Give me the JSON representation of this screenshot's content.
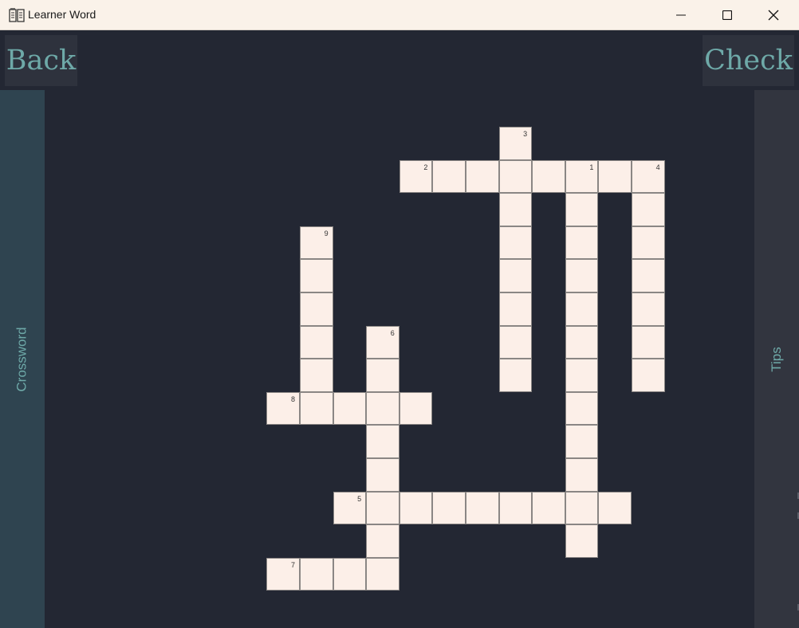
{
  "window": {
    "title": "Learner Word"
  },
  "toolbar": {
    "back_label": "Back",
    "check_label": "Check"
  },
  "sidebar_left": {
    "label": "Crossword"
  },
  "sidebar_right": {
    "label": "Tips"
  },
  "crossword": {
    "clue_numbers": [
      "1",
      "2",
      "3",
      "4",
      "5",
      "6",
      "7",
      "8",
      "9"
    ],
    "cells": [
      [
        0,
        6,
        "3"
      ],
      [
        1,
        3,
        "2"
      ],
      [
        1,
        4,
        ""
      ],
      [
        1,
        5,
        ""
      ],
      [
        1,
        6,
        ""
      ],
      [
        1,
        7,
        ""
      ],
      [
        1,
        8,
        "1"
      ],
      [
        1,
        9,
        ""
      ],
      [
        1,
        10,
        "4"
      ],
      [
        2,
        6,
        ""
      ],
      [
        2,
        8,
        ""
      ],
      [
        2,
        10,
        ""
      ],
      [
        3,
        0,
        "9"
      ],
      [
        3,
        6,
        ""
      ],
      [
        3,
        8,
        ""
      ],
      [
        3,
        10,
        ""
      ],
      [
        4,
        0,
        ""
      ],
      [
        4,
        6,
        ""
      ],
      [
        4,
        8,
        ""
      ],
      [
        4,
        10,
        ""
      ],
      [
        5,
        0,
        ""
      ],
      [
        5,
        6,
        ""
      ],
      [
        5,
        8,
        ""
      ],
      [
        5,
        10,
        ""
      ],
      [
        6,
        0,
        ""
      ],
      [
        6,
        2,
        "6"
      ],
      [
        6,
        6,
        ""
      ],
      [
        6,
        8,
        ""
      ],
      [
        6,
        10,
        ""
      ],
      [
        7,
        0,
        ""
      ],
      [
        7,
        2,
        ""
      ],
      [
        7,
        6,
        ""
      ],
      [
        7,
        8,
        ""
      ],
      [
        7,
        10,
        ""
      ],
      [
        8,
        -1,
        "8"
      ],
      [
        8,
        0,
        ""
      ],
      [
        8,
        1,
        ""
      ],
      [
        8,
        2,
        ""
      ],
      [
        8,
        3,
        ""
      ],
      [
        8,
        8,
        ""
      ],
      [
        9,
        2,
        ""
      ],
      [
        9,
        8,
        ""
      ],
      [
        10,
        2,
        ""
      ],
      [
        10,
        8,
        ""
      ],
      [
        11,
        1,
        "5"
      ],
      [
        11,
        2,
        ""
      ],
      [
        11,
        3,
        ""
      ],
      [
        11,
        4,
        ""
      ],
      [
        11,
        5,
        ""
      ],
      [
        11,
        6,
        ""
      ],
      [
        11,
        7,
        ""
      ],
      [
        11,
        8,
        ""
      ],
      [
        11,
        9,
        ""
      ],
      [
        12,
        2,
        ""
      ],
      [
        12,
        8,
        ""
      ],
      [
        13,
        -1,
        "7"
      ],
      [
        13,
        0,
        ""
      ],
      [
        13,
        1,
        ""
      ],
      [
        13,
        2,
        ""
      ]
    ]
  }
}
